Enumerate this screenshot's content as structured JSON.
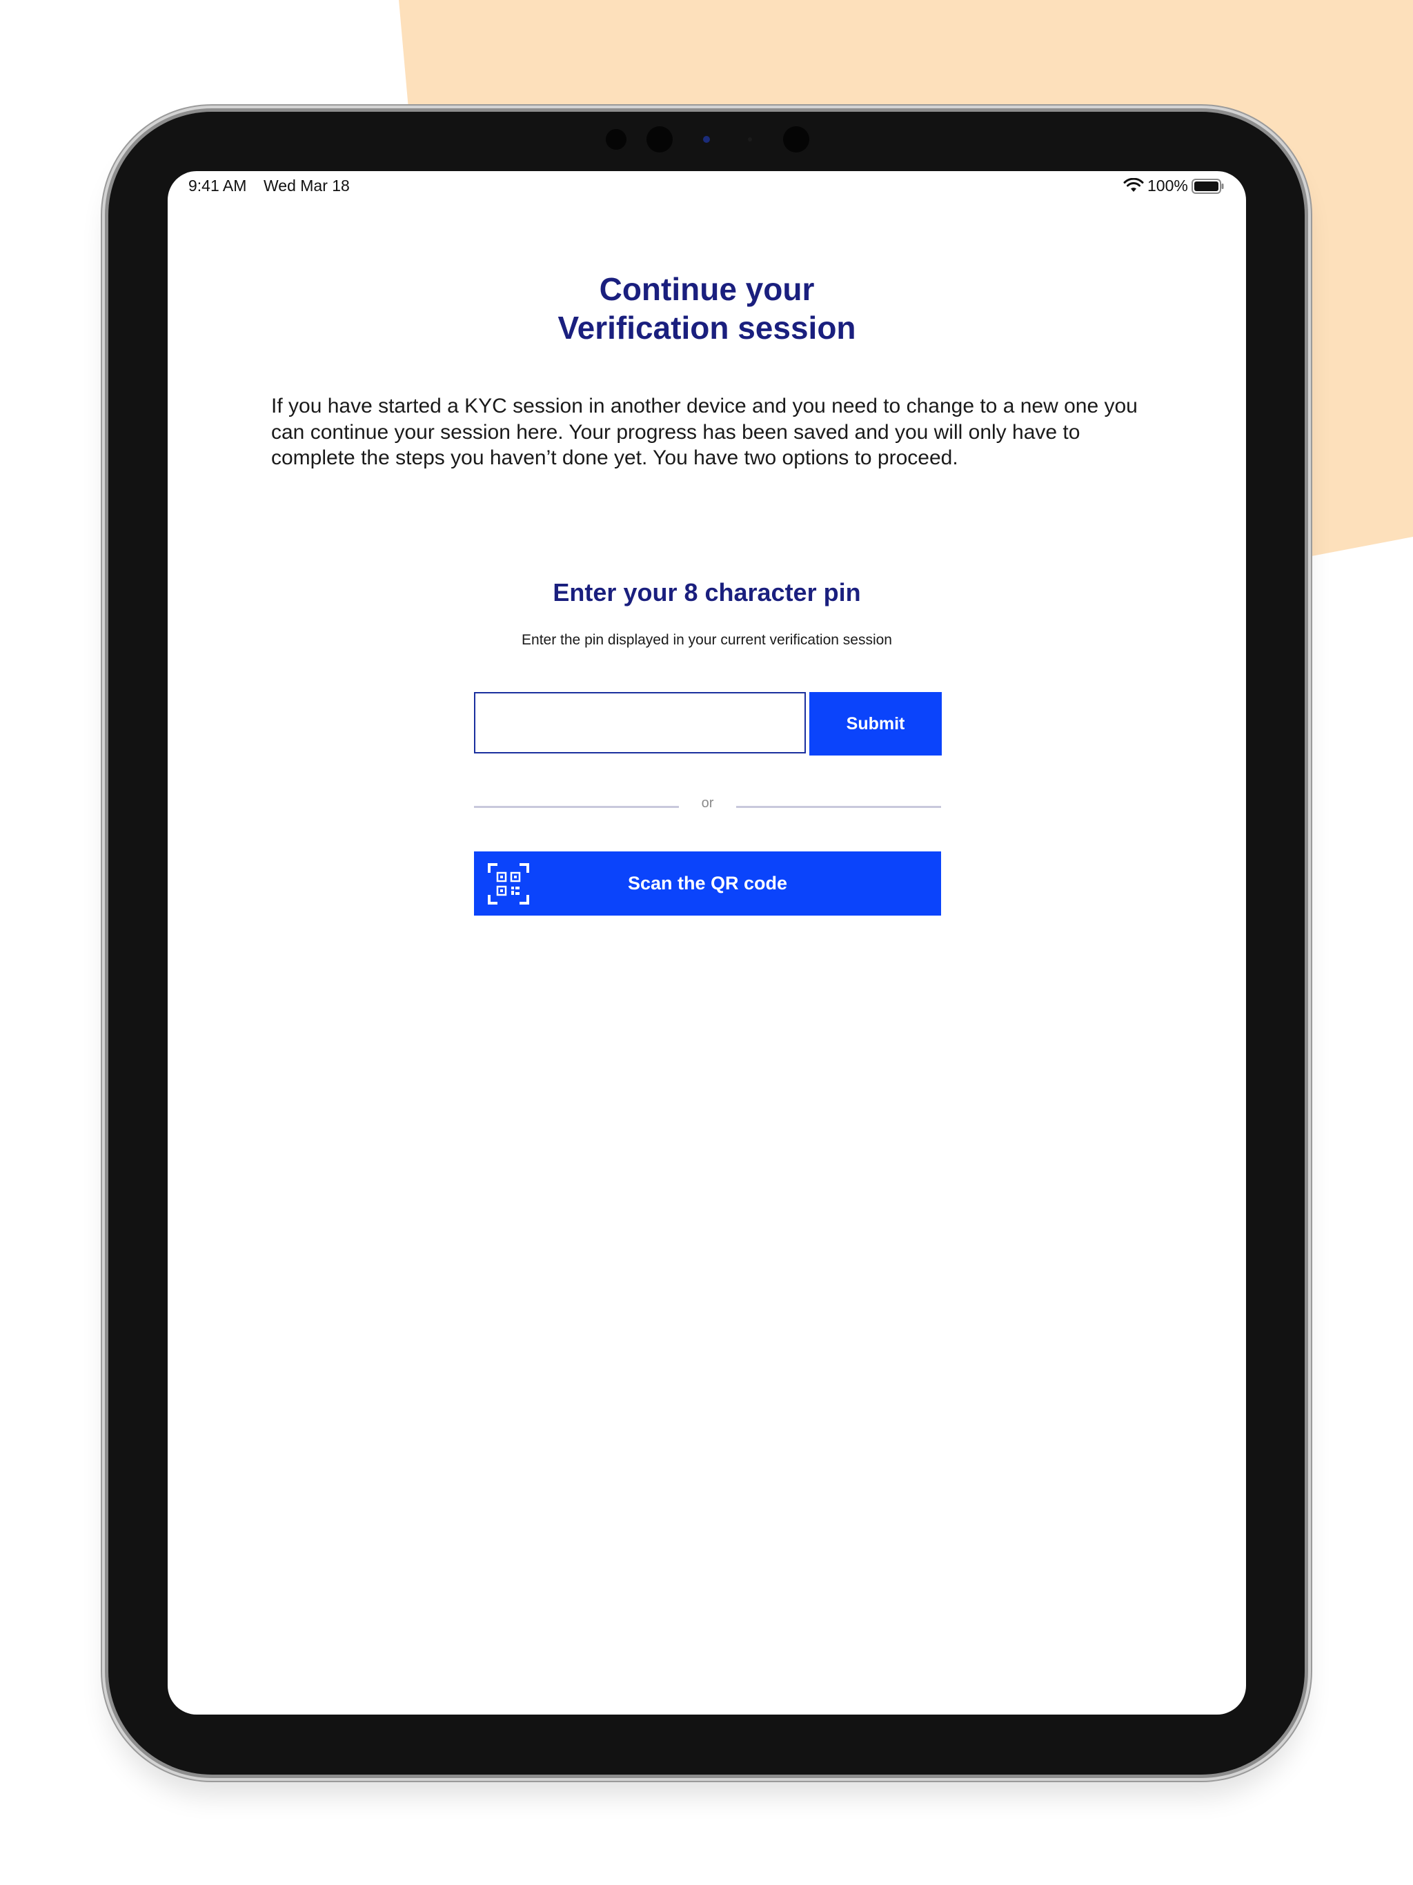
{
  "status_bar": {
    "time": "9:41 AM",
    "date": "Wed Mar 18",
    "battery": "100%"
  },
  "page": {
    "title_line1": "Continue your",
    "title_line2": "Verification session",
    "description": "If you have started a KYC session in another device and you need to change to a new one you can continue your session here. Your progress has been saved and you will only have to complete the steps you haven’t done yet. You have two options to proceed."
  },
  "pin_section": {
    "heading": "Enter your 8 character pin",
    "subheading": "Enter the pin displayed in your current verification session",
    "input_value": "",
    "submit_label": "Submit"
  },
  "divider": {
    "label": "or"
  },
  "qr": {
    "button_label": "Scan the QR code",
    "icon": "qr-code-scan-icon"
  },
  "colors": {
    "accent": "#0b44fb",
    "heading": "#1a1f7e",
    "background_shape": "#fde0bb"
  }
}
